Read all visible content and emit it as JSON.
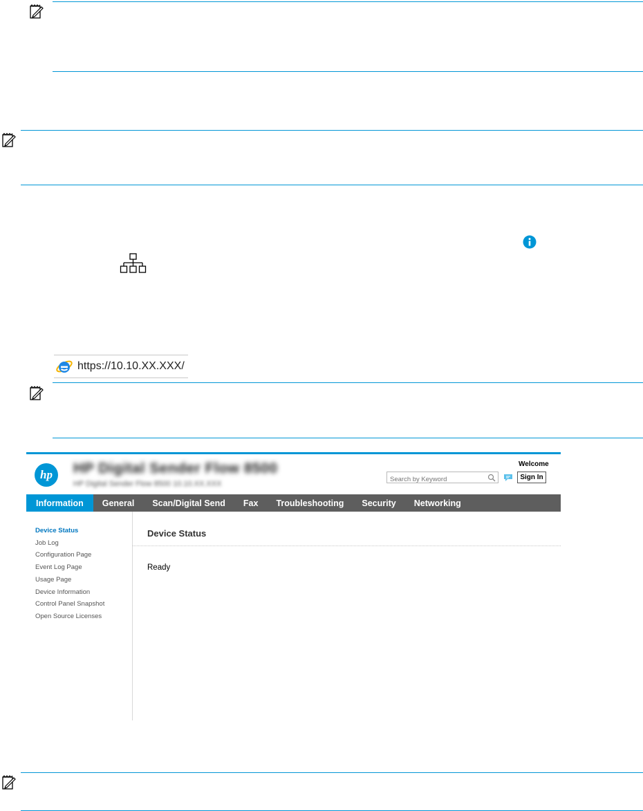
{
  "icons": {
    "note_icon": "notepad-pencil-icon",
    "info_icon": "info-circle-icon",
    "network_icon": "network-topology-icon",
    "browser_icon": "internet-explorer-icon"
  },
  "colors": {
    "rule": "#0096d6",
    "info": "#0096d6",
    "nav_bar": "#5e5e5e",
    "nav_active": "#0096d6",
    "sidebar_active": "#0077c0"
  },
  "address_bar": {
    "url": "https://10.10.XX.XXX/"
  },
  "ews": {
    "logo_text": "hp",
    "device_name": "HP Digital Sender Flow 8500",
    "device_subtitle": "HP Digital Sender Flow 8500    10.10.XX.XXX",
    "search_placeholder": "Search by Keyword",
    "welcome": "Welcome",
    "sign_in": "Sign In",
    "tabs": [
      "Information",
      "General",
      "Scan/Digital Send",
      "Fax",
      "Troubleshooting",
      "Security",
      "Networking"
    ],
    "active_tab": "Information",
    "sidebar": [
      "Device Status",
      "Job Log",
      "Configuration Page",
      "Event Log Page",
      "Usage Page",
      "Device Information",
      "Control Panel Snapshot",
      "Open Source Licenses"
    ],
    "content_title": "Device Status",
    "status": "Ready"
  }
}
